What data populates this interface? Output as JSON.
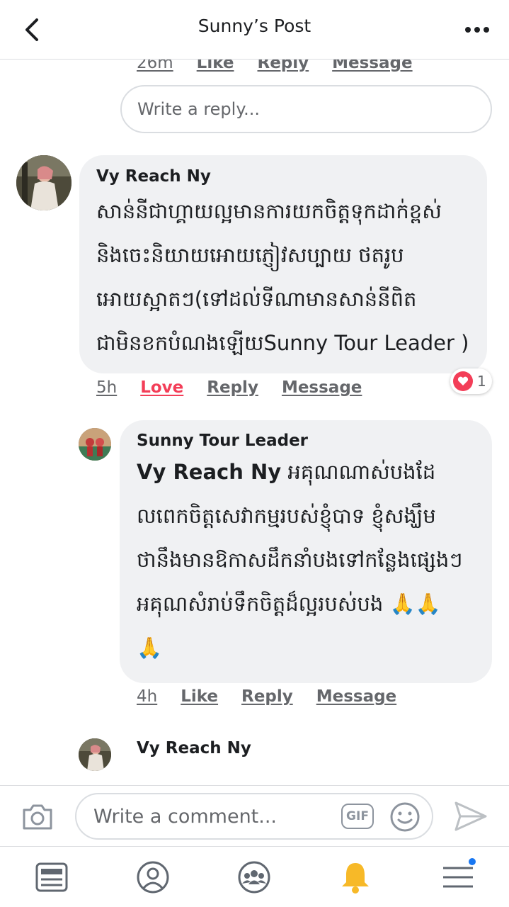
{
  "header": {
    "title": "Sunny’s Post"
  },
  "top_comment_actions": {
    "time": "26m",
    "like": "Like",
    "reply": "Reply",
    "message": "Message"
  },
  "reply_box": {
    "placeholder": "Write a reply..."
  },
  "comment1": {
    "author": "Vy Reach Ny",
    "lines": [
      "សាន់នីជាហ្គាយល្អមានការយកចិត្តទុកដាក់ខ្ពស់",
      "និងចេះនិយាយអោយភ្ញៀវសប្បាយ ថតរូប",
      "អោយស្អាតៗ(ទៅដល់ទីណាមានសាន់នីពិត",
      "ជាមិនខកបំណងឡើយSunny Tour Leader )"
    ],
    "time": "5h",
    "love": "Love",
    "reply": "Reply",
    "message": "Message",
    "reaction_count": "1"
  },
  "comment2": {
    "author": "Sunny Tour Leader",
    "mention": "Vy Reach Ny",
    "line1_rest": " អគុណណាស់បងដែ",
    "lines": [
      "លពេកចិត្តសេវាកម្មរបស់ខ្ញុំបាទ ខ្ញុំសង្ឃឹម",
      "ថានឹងមានឱកាសដឹកនាំបងទៅកន្លែងផ្សេងៗ",
      "អគុណសំរាប់ទឹកចិត្តដ៏ល្អរបស់បង 🙏🙏",
      "🙏"
    ],
    "time": "4h",
    "like": "Like",
    "reply": "Reply",
    "message": "Message"
  },
  "comment3": {
    "author": "Vy Reach Ny"
  },
  "composer": {
    "placeholder": "Write a comment...",
    "gif_label": "GIF"
  },
  "tabs": [
    "news-feed",
    "profile",
    "groups",
    "notifications",
    "menu"
  ],
  "colors": {
    "love": "#f33e58",
    "notification_bell": "#f7b928",
    "notification_dot": "#1877f2",
    "bubble": "#f0f1f3"
  }
}
